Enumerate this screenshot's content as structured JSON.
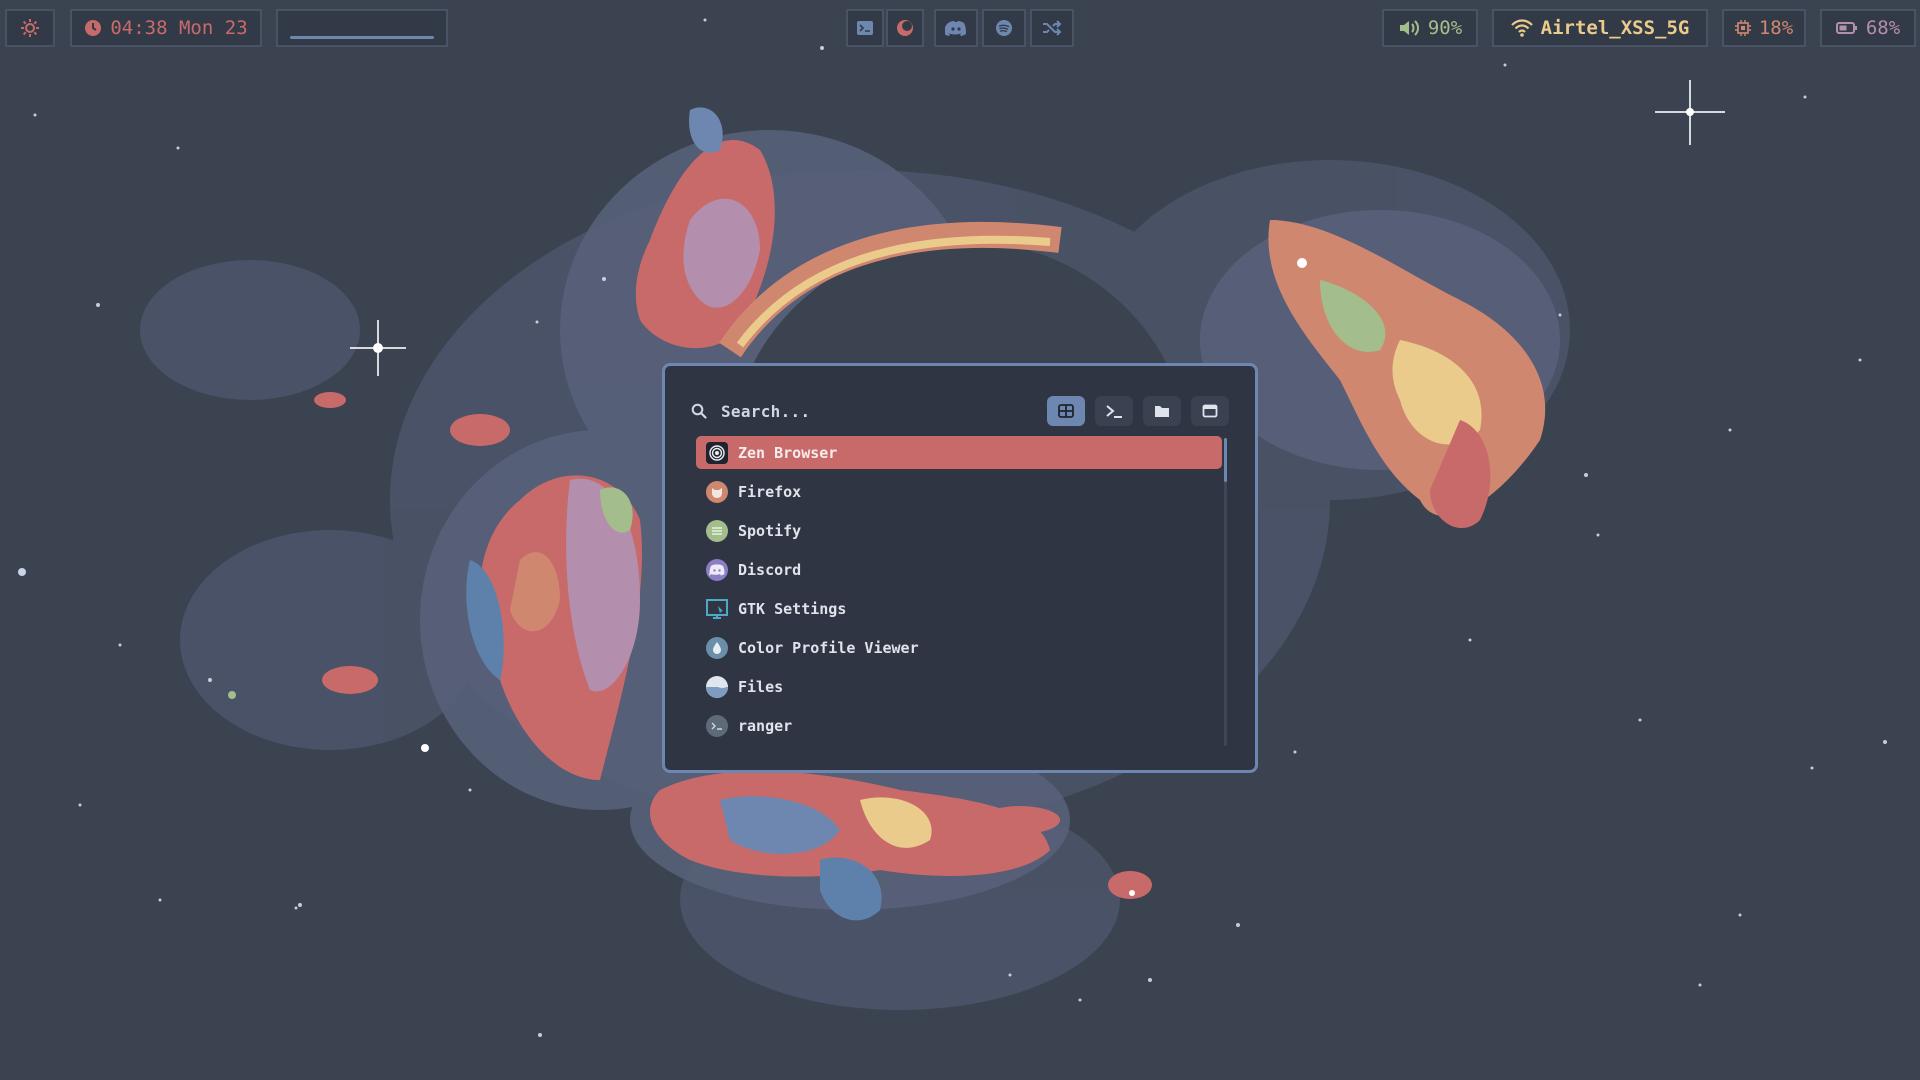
{
  "topbar": {
    "system_menu_icon": "gear-icon",
    "clock": {
      "icon": "clock-icon",
      "text": "04:38 Mon 23"
    },
    "workspaces": {
      "label": ""
    },
    "apps": [
      {
        "name": "terminal",
        "icon": "terminal-icon"
      },
      {
        "name": "browser",
        "icon": "browser-icon"
      },
      {
        "name": "discord",
        "icon": "discord-icon"
      },
      {
        "name": "spotify",
        "icon": "spotify-icon"
      },
      {
        "name": "shuffle",
        "icon": "shuffle-icon"
      }
    ],
    "volume": {
      "icon": "speaker-icon",
      "text": "90%"
    },
    "wifi": {
      "icon": "wifi-icon",
      "text": "Airtel_XSS_5G"
    },
    "cpu": {
      "icon": "cpu-icon",
      "text": "18%"
    },
    "battery": {
      "icon": "battery-icon",
      "text": "68%"
    }
  },
  "launcher": {
    "search": {
      "placeholder": "Search...",
      "icon": "search-icon"
    },
    "modes": [
      {
        "name": "apps",
        "icon": "grid-icon",
        "active": true
      },
      {
        "name": "run",
        "icon": "terminal-prompt-icon",
        "active": false
      },
      {
        "name": "files",
        "icon": "folder-icon",
        "active": false
      },
      {
        "name": "windows",
        "icon": "window-icon",
        "active": false
      }
    ],
    "items": [
      {
        "label": "Zen Browser",
        "icon": "zen-browser-icon",
        "selected": true
      },
      {
        "label": "Firefox",
        "icon": "firefox-icon",
        "selected": false
      },
      {
        "label": "Spotify",
        "icon": "spotify-icon",
        "selected": false
      },
      {
        "label": "Discord",
        "icon": "discord-icon",
        "selected": false
      },
      {
        "label": "GTK Settings",
        "icon": "gtk-settings-icon",
        "selected": false
      },
      {
        "label": "Color Profile Viewer",
        "icon": "color-profile-icon",
        "selected": false
      },
      {
        "label": "Files",
        "icon": "files-icon",
        "selected": false
      },
      {
        "label": "ranger",
        "icon": "ranger-icon",
        "selected": false
      }
    ]
  },
  "colors": {
    "bar_bg": "#333a47",
    "bar_border": "#4a5365",
    "accent_red": "#c96a6a",
    "accent_blue": "#6d87b0",
    "green": "#a3be8c",
    "yellow": "#ebcb8b",
    "orange": "#d08770",
    "purple": "#b48ead"
  }
}
